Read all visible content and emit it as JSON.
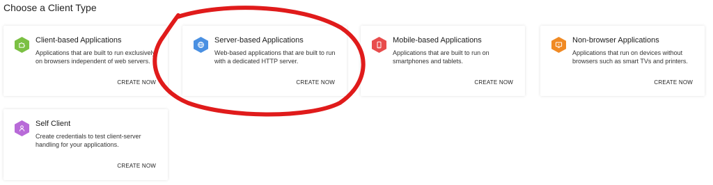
{
  "page": {
    "title": "Choose a Client Type"
  },
  "cards": [
    {
      "title": "Client-based Applications",
      "description": "Applications that are built to run exclusively on browsers independent of web servers.",
      "action": "CREATE NOW",
      "icon": "puzzle-icon",
      "color": "#7bc043"
    },
    {
      "title": "Server-based Applications",
      "description": "Web-based applications that are built to run with a dedicated HTTP server.",
      "action": "CREATE NOW",
      "icon": "globe-icon",
      "color": "#4a90e2"
    },
    {
      "title": "Mobile-based Applications",
      "description": "Applications that are built to run on smartphones and tablets.",
      "action": "CREATE NOW",
      "icon": "smartphone-icon",
      "color": "#e84c4c"
    },
    {
      "title": "Non-browser Applications",
      "description": "Applications that run on devices without browsers such as smart TVs and printers.",
      "action": "CREATE NOW",
      "icon": "tv-icon",
      "color": "#f08a24"
    },
    {
      "title": "Self Client",
      "description": "Create credentials to test client-server handling for your applications.",
      "action": "CREATE NOW",
      "icon": "user-icon",
      "color": "#b86ad8"
    }
  ],
  "annotation": {
    "color": "#e01b1b"
  }
}
